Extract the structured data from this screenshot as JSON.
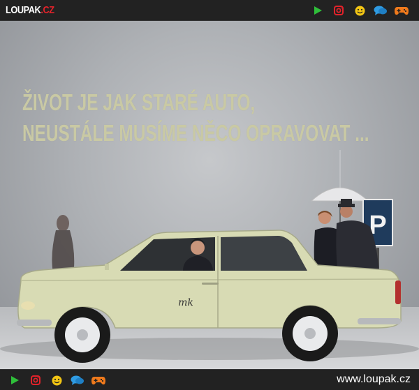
{
  "header": {
    "logo_text": "LOUPAK",
    "logo_tld": ".CZ",
    "icons": [
      "play-icon",
      "instagram-icon",
      "smiley-icon",
      "chat-icon",
      "gamepad-icon"
    ]
  },
  "image": {
    "caption_line1": "ŽIVOT JE JAK STARÉ AUTO,",
    "caption_line2": "NEUSTÁLE MUSÍME NĚCO OPRAVOVAT ...",
    "parking_sign": "P",
    "car_signature": "mk"
  },
  "footer": {
    "icons": [
      "play-icon",
      "instagram-icon",
      "smiley-icon",
      "chat-icon",
      "gamepad-icon"
    ],
    "site_url": "www.loupak.cz"
  },
  "colors": {
    "bar_bg": "#222222",
    "play": "#2fbf3a",
    "instagram": "#e2222a",
    "smiley": "#f3c614",
    "chat": "#2f9be2",
    "gamepad": "#f07a1c",
    "car_body": "#d8dbb4",
    "caption": "#c9c9a4"
  }
}
